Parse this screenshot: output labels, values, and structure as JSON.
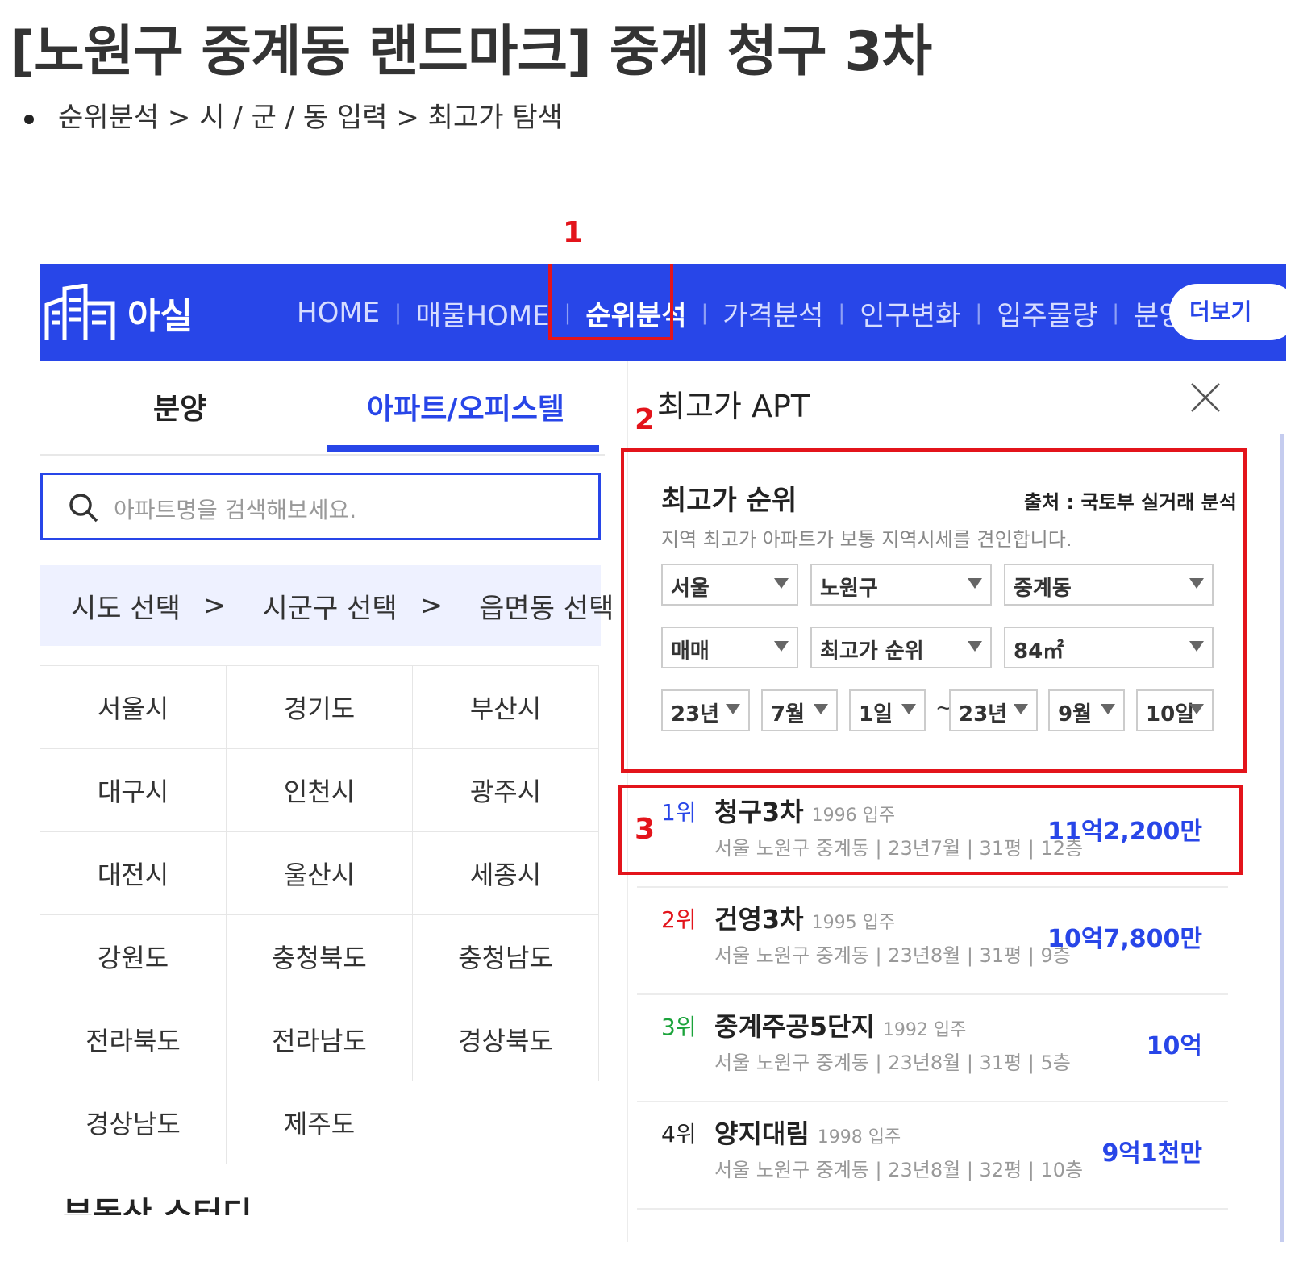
{
  "post": {
    "title": "[노원구 중계동 랜드마크] 중계 청구 3차",
    "path": "순위분석 > 시 / 군 / 동 입력 > 최고가 탐색"
  },
  "annotations": [
    "1",
    "2",
    "3"
  ],
  "header": {
    "logo_text": "아실",
    "nav": [
      "HOME",
      "매물HOME",
      "순위분석",
      "가격분석",
      "인구변화",
      "입주물량",
      "분양"
    ],
    "nav_separator": "|",
    "active_nav": "순위분석",
    "more": "더보기",
    "bg_color": "#2846e8"
  },
  "left": {
    "tabs": [
      "분양",
      "아파트/오피스텔"
    ],
    "active_tab": "아파트/오피스텔",
    "search_placeholder": "아파트명을 검색해보세요.",
    "region_steps": [
      "시도 선택",
      "시군구 선택",
      "읍면동 선택"
    ],
    "region_arrow": ">",
    "regions": [
      "서울시",
      "경기도",
      "부산시",
      "대구시",
      "인천시",
      "광주시",
      "대전시",
      "울산시",
      "세종시",
      "강원도",
      "충청북도",
      "충청남도",
      "전라북도",
      "전라남도",
      "경상북도",
      "경상남도",
      "제주도"
    ],
    "below_text": "부동산 스터디"
  },
  "right": {
    "title": "최고가 APT",
    "filter": {
      "title": "최고가 순위",
      "source": "출처 : 국토부 실거래 분석",
      "desc": "지역 최고가 아파트가 보통 지역시세를 견인합니다.",
      "sido": "서울",
      "sigungu": "노원구",
      "dong": "중계동",
      "deal": "매매",
      "sort": "최고가 순위",
      "area": "84㎡",
      "from_year": "23년",
      "from_month": "7월",
      "from_day": "1일",
      "range_sep": "~",
      "to_year": "23년",
      "to_month": "9월",
      "to_day": "10일"
    },
    "ranks": [
      {
        "rank": "1위",
        "name": "청구3차",
        "year": "1996 입주",
        "info": "서울 노원구 중계동 | 23년7월 | 31평 | 12층",
        "price": "11억2,200만",
        "rank_color": "#2846e8"
      },
      {
        "rank": "2위",
        "name": "건영3차",
        "year": "1995 입주",
        "info": "서울 노원구 중계동 | 23년8월 | 31평 | 9층",
        "price": "10억7,800만",
        "rank_color": "#e3141b"
      },
      {
        "rank": "3위",
        "name": "중계주공5단지",
        "year": "1992 입주",
        "info": "서울 노원구 중계동 | 23년8월 | 31평 | 5층",
        "price": "10억",
        "rank_color": "#1aa33a"
      },
      {
        "rank": "4위",
        "name": "양지대림",
        "year": "1998 입주",
        "info": "서울 노원구 중계동 | 23년8월 | 32평 | 10층",
        "price": "9억1천만",
        "rank_color": "#222222"
      }
    ]
  }
}
